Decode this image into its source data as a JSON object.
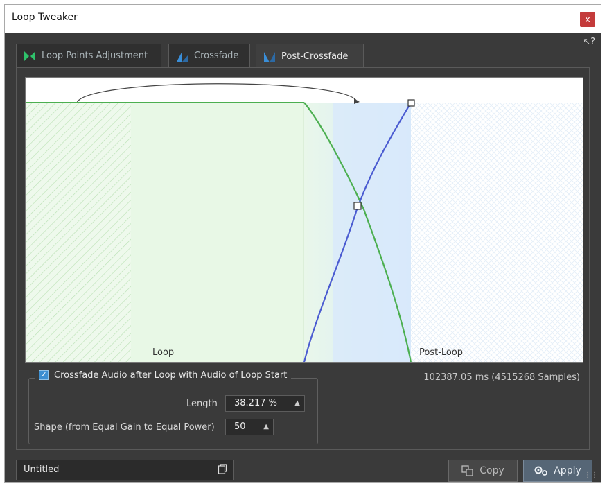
{
  "window": {
    "title": "Loop Tweaker",
    "close_label": "x",
    "help_label": "?"
  },
  "tabs": [
    {
      "label": "Loop Points Adjustment",
      "active": false
    },
    {
      "label": "Crossfade",
      "active": false
    },
    {
      "label": "Post-Crossfade",
      "active": true
    }
  ],
  "plot": {
    "loop_label": "Loop",
    "post_loop_label": "Post-Loop",
    "colors": {
      "loop_fill": "#e8f8e6",
      "crossfade_fill": "#dcebfb",
      "fade_out_curve": "#4caf50",
      "fade_in_curve": "#4a5bd1"
    }
  },
  "options": {
    "crossfade_checkbox_label": "Crossfade Audio after Loop with Audio of Loop Start",
    "crossfade_checked": true,
    "length_label": "Length",
    "length_value": "38.217 %",
    "shape_label": "Shape (from Equal Gain to Equal Power)",
    "shape_value": "50"
  },
  "duration_text": "102387.05 ms (4515268 Samples)",
  "preset_name": "Untitled",
  "buttons": {
    "copy_label": "Copy",
    "apply_label": "Apply"
  }
}
